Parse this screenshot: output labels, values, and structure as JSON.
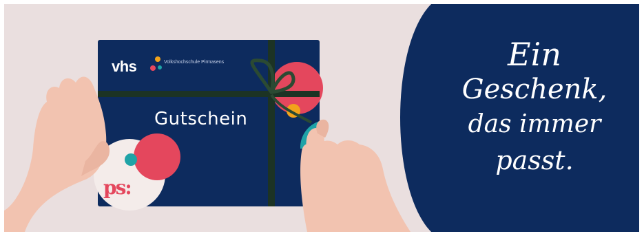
{
  "voucher": {
    "logo_text": "vhs",
    "logo_subtitle": "Volkshochschule Pirmasens",
    "title": "Gutschein",
    "partner_logo_text": "ps:"
  },
  "slogan": {
    "line1": "Ein",
    "line2": "Geschenk,",
    "line3": "das immer",
    "line4": "passt."
  },
  "colors": {
    "background": "#eadfdf",
    "navy": "#0d2b5e",
    "coral": "#e4475d",
    "teal": "#1fa3a7",
    "orange": "#f2a31b",
    "ribbon": "#1c3324",
    "skin": "#f2c3b0"
  }
}
